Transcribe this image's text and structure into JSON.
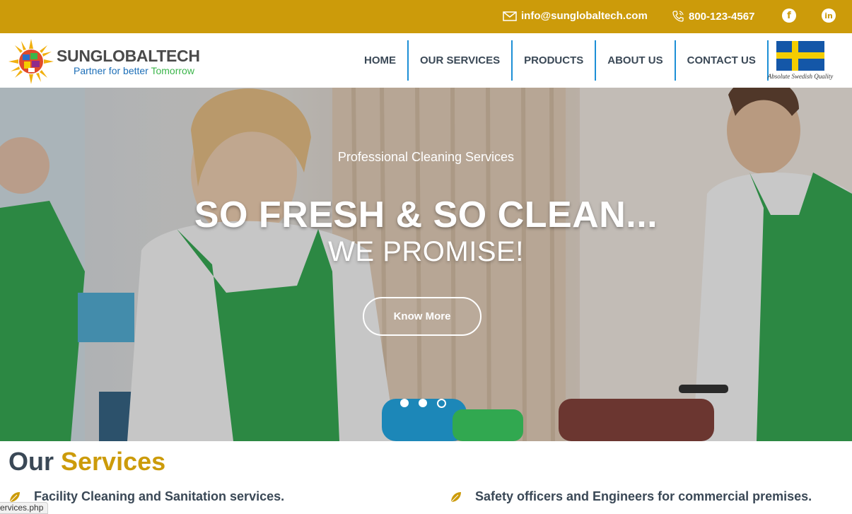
{
  "topbar": {
    "email": "info@sunglobaltech.com",
    "phone": "800-123-4567",
    "social": [
      "facebook-icon",
      "linkedin-icon"
    ]
  },
  "logo": {
    "name": "SUNGLOBALTECH",
    "tagline_a": "Partner for better ",
    "tagline_b": "Tomorrow"
  },
  "nav": {
    "items": [
      "HOME",
      "OUR SERVICES",
      "PRODUCTS",
      "ABOUT US",
      "CONTACT US"
    ]
  },
  "flag": {
    "caption": "Absolute Swedish Quality"
  },
  "hero": {
    "subtitle": "Professional Cleaning Services",
    "title": "SO FRESH & SO CLEAN...",
    "title2": "WE PROMISE!",
    "button": "Know More",
    "slides": 3,
    "active_slide": 3
  },
  "services": {
    "title_a": "Our ",
    "title_b": "Services",
    "items": [
      "Facility Cleaning and Sanitation services.",
      "Safety officers and Engineers for commercial premises."
    ]
  },
  "status_bar": {
    "url": "ervices.php"
  },
  "colors": {
    "gold": "#cc9b0a",
    "nav_text": "#3a4856",
    "nav_divider": "#1d8fd6"
  }
}
